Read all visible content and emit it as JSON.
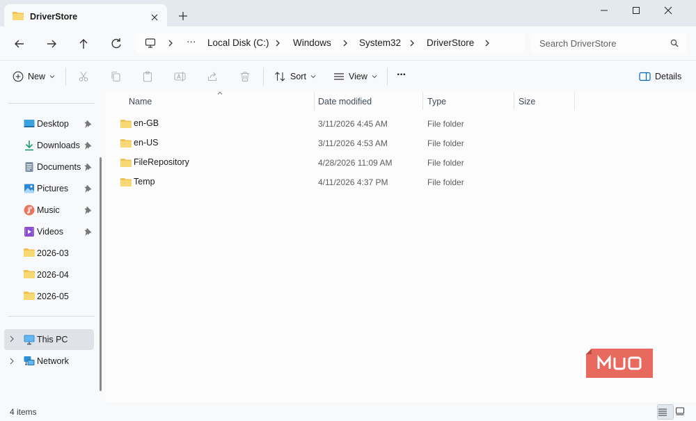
{
  "window": {
    "tab_title": "DriverStore",
    "new_tab_glyph": "+"
  },
  "address": {
    "overflow": "···",
    "crumbs": [
      "Local Disk (C:)",
      "Windows",
      "System32",
      "DriverStore"
    ]
  },
  "search": {
    "placeholder": "Search DriverStore"
  },
  "toolbar": {
    "new_label": "New",
    "sort_label": "Sort",
    "view_label": "View",
    "more_glyph": "···",
    "details_label": "Details"
  },
  "sidebar": {
    "quick_access": [
      {
        "label": "Desktop",
        "icon": "desktop-icon",
        "pinned": true
      },
      {
        "label": "Downloads",
        "icon": "download-icon",
        "pinned": true
      },
      {
        "label": "Documents",
        "icon": "documents-icon",
        "pinned": true
      },
      {
        "label": "Pictures",
        "icon": "pictures-icon",
        "pinned": true
      },
      {
        "label": "Music",
        "icon": "music-icon",
        "pinned": true
      },
      {
        "label": "Videos",
        "icon": "videos-icon",
        "pinned": true
      },
      {
        "label": "2026-03",
        "icon": "folder-icon",
        "pinned": false
      },
      {
        "label": "2026-04",
        "icon": "folder-icon",
        "pinned": false
      },
      {
        "label": "2026-05",
        "icon": "folder-icon",
        "pinned": false
      }
    ],
    "this_pc": "This PC",
    "network": "Network"
  },
  "columns": {
    "name": "Name",
    "date": "Date modified",
    "type": "Type",
    "size": "Size"
  },
  "files": [
    {
      "name": "en-GB",
      "date": "3/11/2026 4:45 AM",
      "type": "File folder",
      "size": ""
    },
    {
      "name": "en-US",
      "date": "3/11/2026 4:53 AM",
      "type": "File folder",
      "size": ""
    },
    {
      "name": "FileRepository",
      "date": "4/28/2026 11:09 AM",
      "type": "File folder",
      "size": ""
    },
    {
      "name": "Temp",
      "date": "4/11/2026 4:37 PM",
      "type": "File folder",
      "size": ""
    }
  ],
  "status": {
    "item_count": "4 items"
  },
  "watermark": {
    "text": "MUO",
    "color": "#e86a5e"
  },
  "colors": {
    "folder": "#f2c14e",
    "accent": "#0067c0"
  }
}
